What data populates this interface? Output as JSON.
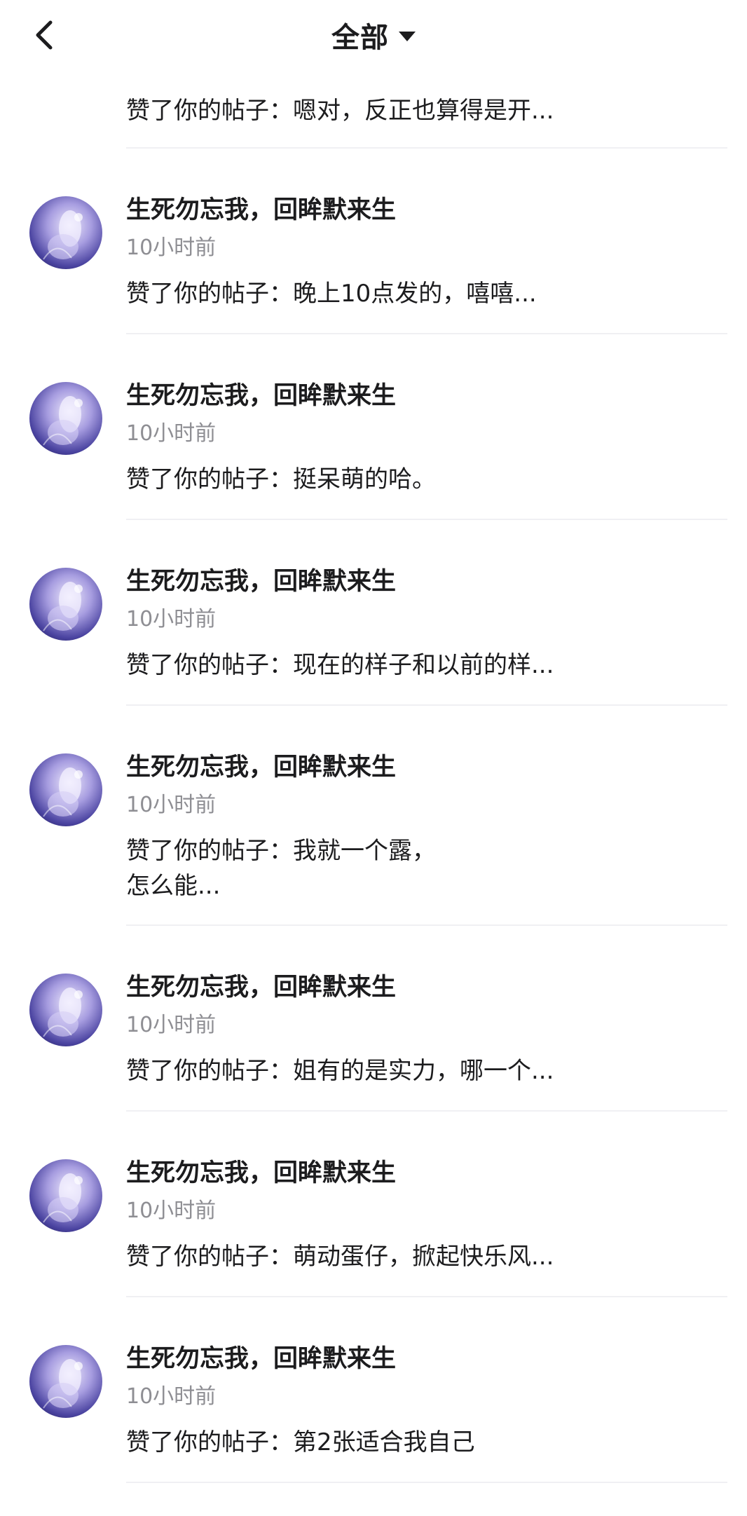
{
  "header": {
    "title": "全部",
    "back_icon": "chevron-left-icon",
    "dropdown_icon": "caret-down-icon"
  },
  "partial_item": {
    "message": "赞了你的帖子：嗯对，反正也算得是开..."
  },
  "notifications": [
    {
      "name": "生死勿忘我，回眸默来生",
      "time": "10小时前",
      "message": "赞了你的帖子：晚上10点发的，嘻嘻..."
    },
    {
      "name": "生死勿忘我，回眸默来生",
      "time": "10小时前",
      "message": "赞了你的帖子：挺呆萌的哈。"
    },
    {
      "name": "生死勿忘我，回眸默来生",
      "time": "10小时前",
      "message": "赞了你的帖子：现在的样子和以前的样..."
    },
    {
      "name": "生死勿忘我，回眸默来生",
      "time": "10小时前",
      "message": "赞了你的帖子：我就一个露，\n怎么能..."
    },
    {
      "name": "生死勿忘我，回眸默来生",
      "time": "10小时前",
      "message": "赞了你的帖子：姐有的是实力，哪一个..."
    },
    {
      "name": "生死勿忘我，回眸默来生",
      "time": "10小时前",
      "message": "赞了你的帖子：萌动蛋仔，掀起快乐风..."
    },
    {
      "name": "生死勿忘我，回眸默来生",
      "time": "10小时前",
      "message": "赞了你的帖子：第2张适合我自己"
    }
  ]
}
